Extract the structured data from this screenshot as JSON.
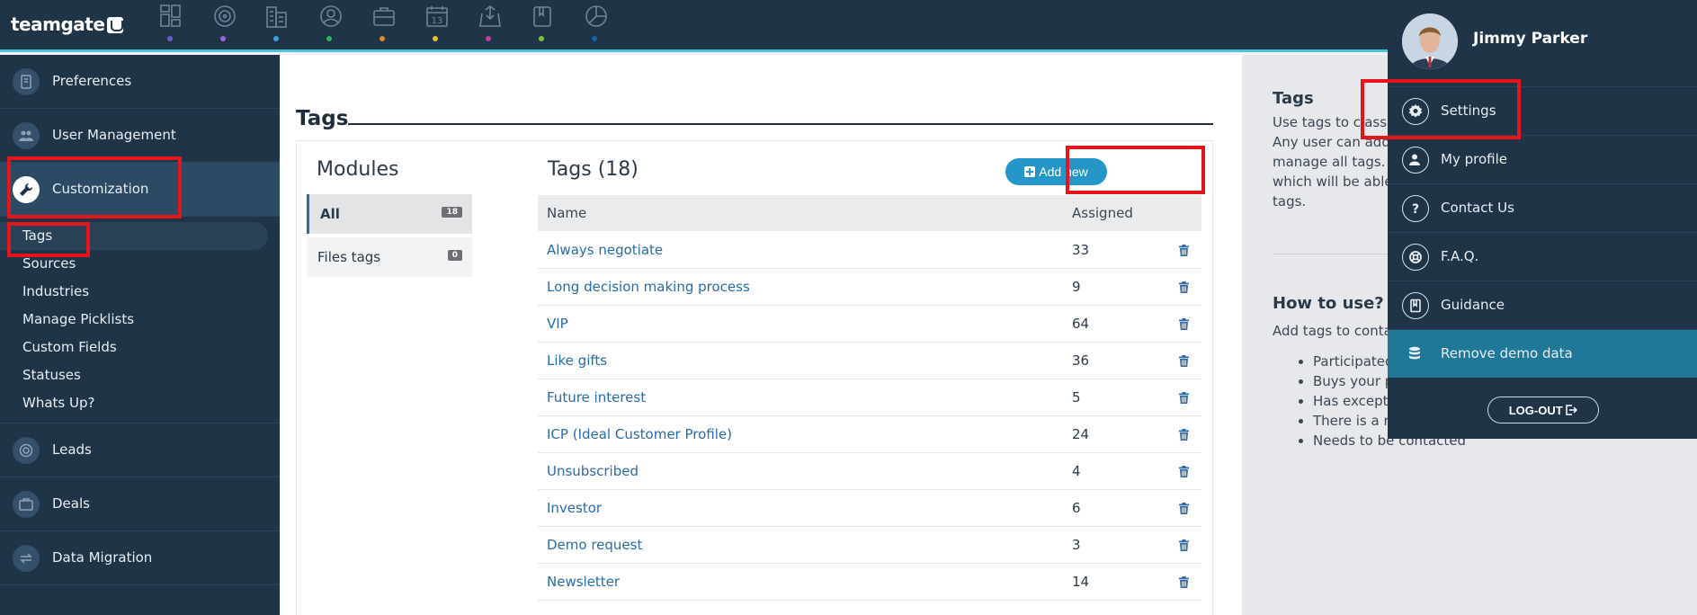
{
  "app": {
    "logo": "teamgate"
  },
  "nav_colors": [
    "#6a5acd",
    "#a45ee5",
    "#3aa0e0",
    "#28b463",
    "#e08a2c",
    "#e6c229",
    "#c2379b",
    "#7cc43b",
    "#1b5fa8"
  ],
  "nav_icons": [
    "dashboard-icon",
    "target-icon",
    "companies-icon",
    "contacts-icon",
    "deals-icon",
    "calendar-icon",
    "inbox-icon",
    "files-icon",
    "reports-icon"
  ],
  "calendar_day": "13",
  "sidebar": {
    "preferences": "Preferences",
    "user_management": "User Management",
    "customization": "Customization",
    "sub_items": [
      "Tags",
      "Sources",
      "Industries",
      "Manage Picklists",
      "Custom Fields",
      "Statuses",
      "Whats Up?"
    ],
    "leads": "Leads",
    "deals": "Deals",
    "data_migration": "Data Migration"
  },
  "main": {
    "title": "Tags",
    "modules_title": "Modules",
    "modules": [
      {
        "label": "All",
        "count": "18"
      },
      {
        "label": "Files tags",
        "count": "0"
      }
    ],
    "tags_title": "Tags (18)",
    "add_new": "Add new",
    "columns": {
      "name": "Name",
      "assigned": "Assigned"
    },
    "rows": [
      {
        "name": "Always negotiate",
        "assigned": "33"
      },
      {
        "name": "Long decision making process",
        "assigned": "9"
      },
      {
        "name": "VIP",
        "assigned": "64"
      },
      {
        "name": "Like gifts",
        "assigned": "36"
      },
      {
        "name": "Future interest",
        "assigned": "5"
      },
      {
        "name": "ICP (Ideal Customer Profile)",
        "assigned": "24"
      },
      {
        "name": "Unsubscribed",
        "assigned": "4"
      },
      {
        "name": "Investor",
        "assigned": "6"
      },
      {
        "name": "Demo request",
        "assigned": "3"
      },
      {
        "name": "Newsletter",
        "assigned": "14"
      }
    ]
  },
  "info": {
    "title1": "Tags",
    "lines1": [
      "Use tags to classi",
      "Any user can add",
      "manage all tags. A",
      "which will be able",
      "tags."
    ],
    "title2": "How to use?",
    "line2": "Add tags to conta",
    "bullets": [
      "Participated",
      "Buys your p",
      "Has except",
      "There is a r",
      "Needs to be contacted"
    ]
  },
  "profile": {
    "name": "Jimmy Parker",
    "menu": [
      "Settings",
      "My profile",
      "Contact Us",
      "F.A.Q.",
      "Guidance",
      "Remove demo data"
    ],
    "logout": "LOG-OUT"
  },
  "colors": {
    "dark": "#1f3447",
    "accent": "#2596c8",
    "link": "#2a6aa8",
    "annotation": "#e8141b"
  }
}
